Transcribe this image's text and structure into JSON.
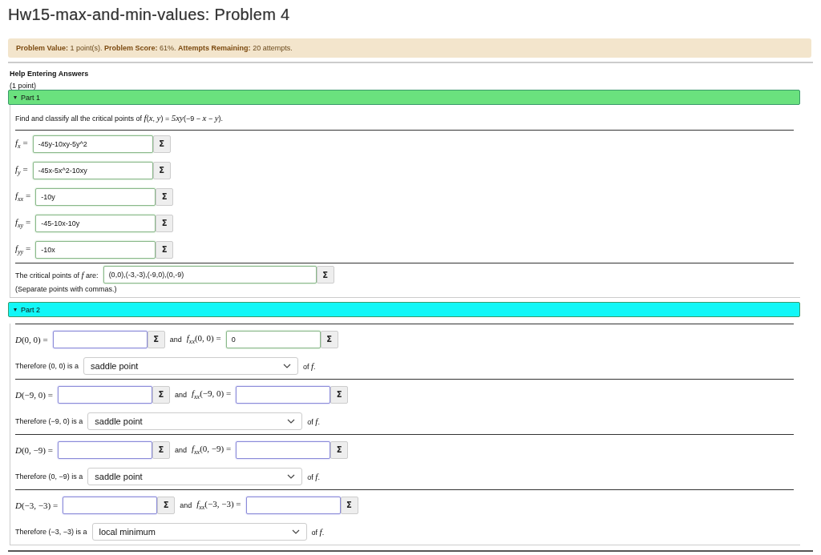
{
  "title": "Hw15-max-and-min-values: Problem 4",
  "status_banner": "**Problem Value:** 1 point(s). **Problem Score:** 61%. **Attempts Remaining:** 20 attempts.",
  "help_link": "Help Entering Answers",
  "points": "(1 point)",
  "part1": {
    "header": "Part 1",
    "expanded": true,
    "prompt": "Find and classify all the critical points of *f*(*x*, *y*) = *5xy*(−9 − *x* − *y*).",
    "derivatives": [
      {
        "label": "*f*$_{x}$ =",
        "value": "-45y-10xy-5y^2",
        "answered": true,
        "button": "Σ"
      },
      {
        "label": "*f*$_{y}$ =",
        "value": "-45x-5x^2-10xy",
        "answered": true,
        "button": "Σ"
      },
      {
        "label": "*f*$_{xx}$ =",
        "value": "-10y",
        "answered": true,
        "button": "Σ"
      },
      {
        "label": "*f*$_{xy}$ =",
        "value": "-45-10x-10y",
        "answered": true,
        "button": "Σ"
      },
      {
        "label": "*f*$_{yy}$ =",
        "value": "-10x",
        "answered": true,
        "button": "Σ"
      }
    ],
    "critical": {
      "label": "The critical points of *f* are:",
      "value": "(0,0),(-3,-3),(-9,0),(0,-9)",
      "answered": true,
      "button": "Σ",
      "note": "(Separate points with commas.)"
    }
  },
  "part2": {
    "header": "Part 2",
    "expanded": true,
    "points": [
      {
        "d_label": "*D*(0, 0) =",
        "d_answered": false,
        "d_button": "Σ",
        "and": "and",
        "fxx_label": "*f*$_{xx}$(0, 0) =",
        "fxx_value": "0",
        "fxx_answered": true,
        "fxx_button": "Σ",
        "therefore": "Therefore (0, 0) is a",
        "choice": "saddle point",
        "suffix": "of *f*."
      },
      {
        "d_label": "*D*(−9, 0) =",
        "d_answered": false,
        "d_button": "Σ",
        "and": "and",
        "fxx_label": "*f*$_{xx}$(−9, 0) =",
        "fxx_answered": false,
        "fxx_button": "Σ",
        "therefore": "Therefore (−9, 0) is a",
        "choice": "saddle point",
        "suffix": "of *f*."
      },
      {
        "d_label": "*D*(0, −9) =",
        "d_answered": false,
        "d_button": "Σ",
        "and": "and",
        "fxx_label": "*f*$_{xx}$(0, −9) =",
        "fxx_answered": false,
        "fxx_button": "Σ",
        "therefore": "Therefore (0, −9) is a",
        "choice": "saddle point",
        "suffix": "of *f*."
      },
      {
        "d_label": "*D*(−3, −3) =",
        "d_answered": false,
        "d_button": "Σ",
        "and": "and",
        "fxx_label": "*f*$_{xx}$(−3, −3) =",
        "fxx_answered": false,
        "fxx_button": "Σ",
        "therefore": "Therefore (−3, −3) is a",
        "choice": "local minimum",
        "suffix": "of *f*."
      }
    ]
  }
}
